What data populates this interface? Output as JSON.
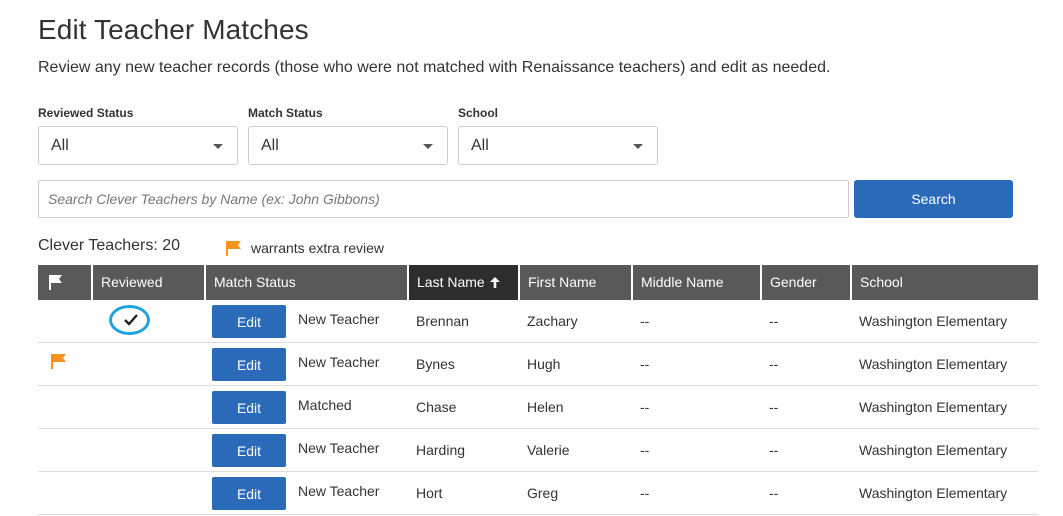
{
  "page": {
    "title": "Edit Teacher Matches",
    "subtitle": "Review any new teacher records (those who were not matched with Renaissance teachers) and edit as needed."
  },
  "filters": [
    {
      "label": "Reviewed Status",
      "value": "All"
    },
    {
      "label": "Match Status",
      "value": "All"
    },
    {
      "label": "School",
      "value": "All"
    }
  ],
  "search": {
    "placeholder": "Search Clever Teachers by Name (ex: John Gibbons)",
    "value": "",
    "button_label": "Search"
  },
  "summary": {
    "count_label": "Clever Teachers: 20",
    "legend_label": "warrants extra review"
  },
  "colors": {
    "accent": "#2a6ab8",
    "flag": "#f7941d",
    "header": "#595959",
    "header_sorted": "#2d2d2d",
    "reviewed_ring": "#1fa3e0"
  },
  "table": {
    "columns": [
      {
        "key": "flag",
        "label": "",
        "icon": "flag-icon"
      },
      {
        "key": "reviewed",
        "label": "Reviewed"
      },
      {
        "key": "match_status",
        "label": "Match Status"
      },
      {
        "key": "last_name",
        "label": "Last Name",
        "sort": "ascending",
        "sort_icon": "arrow-up-icon"
      },
      {
        "key": "first_name",
        "label": "First Name"
      },
      {
        "key": "middle_name",
        "label": "Middle Name"
      },
      {
        "key": "gender",
        "label": "Gender"
      },
      {
        "key": "school",
        "label": "School"
      }
    ],
    "edit_label": "Edit",
    "rows": [
      {
        "flagged": false,
        "reviewed": true,
        "match_status": "New Teacher",
        "last_name": "Brennan",
        "first_name": "Zachary",
        "middle_name": "--",
        "gender": "--",
        "school": "Washington Elementary"
      },
      {
        "flagged": true,
        "reviewed": false,
        "match_status": "New Teacher",
        "last_name": "Bynes",
        "first_name": "Hugh",
        "middle_name": "--",
        "gender": "--",
        "school": "Washington Elementary"
      },
      {
        "flagged": false,
        "reviewed": false,
        "match_status": "Matched",
        "last_name": "Chase",
        "first_name": "Helen",
        "middle_name": "--",
        "gender": "--",
        "school": "Washington Elementary"
      },
      {
        "flagged": false,
        "reviewed": false,
        "match_status": "New Teacher",
        "last_name": "Harding",
        "first_name": "Valerie",
        "middle_name": "--",
        "gender": "--",
        "school": "Washington Elementary"
      },
      {
        "flagged": false,
        "reviewed": false,
        "match_status": "New Teacher",
        "last_name": "Hort",
        "first_name": "Greg",
        "middle_name": "--",
        "gender": "--",
        "school": "Washington Elementary"
      }
    ]
  }
}
